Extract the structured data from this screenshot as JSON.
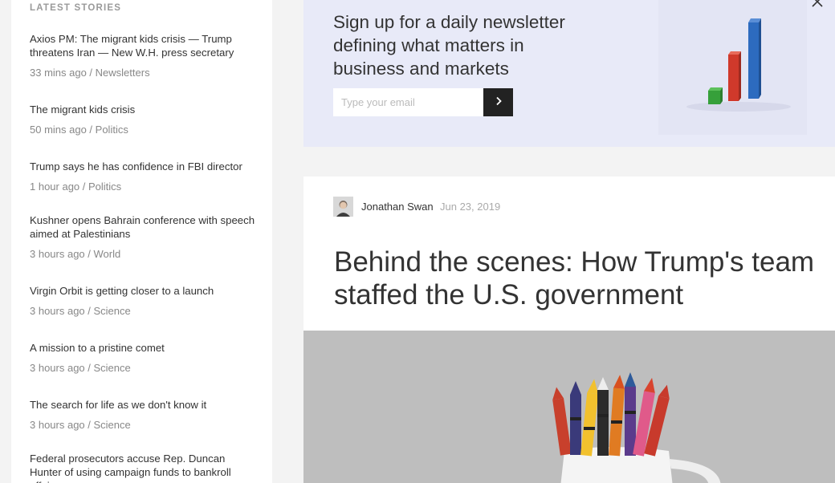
{
  "sidebar": {
    "heading": "LATEST STORIES",
    "stories": [
      {
        "title": "Axios PM: The migrant kids crisis — Trump threatens Iran — New W.H. press secretary",
        "meta": "33 mins ago / Newsletters"
      },
      {
        "title": "The migrant kids crisis",
        "meta": "50 mins ago / Politics"
      },
      {
        "title": "Trump says he has confidence in FBI director",
        "meta": "1 hour ago / Politics"
      },
      {
        "title": "Kushner opens Bahrain conference with speech aimed at Palestinians",
        "meta": "3 hours ago / World"
      },
      {
        "title": "Virgin Orbit is getting closer to a launch",
        "meta": "3 hours ago / Science"
      },
      {
        "title": "A mission to a pristine comet",
        "meta": "3 hours ago / Science"
      },
      {
        "title": "The search for life as we don't know it",
        "meta": "3 hours ago / Science"
      },
      {
        "title": "Federal prosecutors accuse Rep. Duncan Hunter of using campaign funds to bankroll affairs",
        "meta": ""
      }
    ]
  },
  "newsletter": {
    "headline": "Sign up for a daily newsletter defining what matters in business and markets",
    "email_placeholder": "Type your email",
    "submit_icon": "chevron-right-icon",
    "close_icon": "close-icon",
    "art_icon": "bar-chart-icon"
  },
  "article": {
    "author": "Jonathan Swan",
    "date": "Jun 23, 2019",
    "headline": "Behind the scenes: How Trump's team staffed the U.S. government",
    "image_icon": "crayons-in-mug-image"
  },
  "colors": {
    "newsletter_bg": "#e8eaf8",
    "button_dark": "#222222",
    "hero_bg": "#bdbdbd"
  }
}
